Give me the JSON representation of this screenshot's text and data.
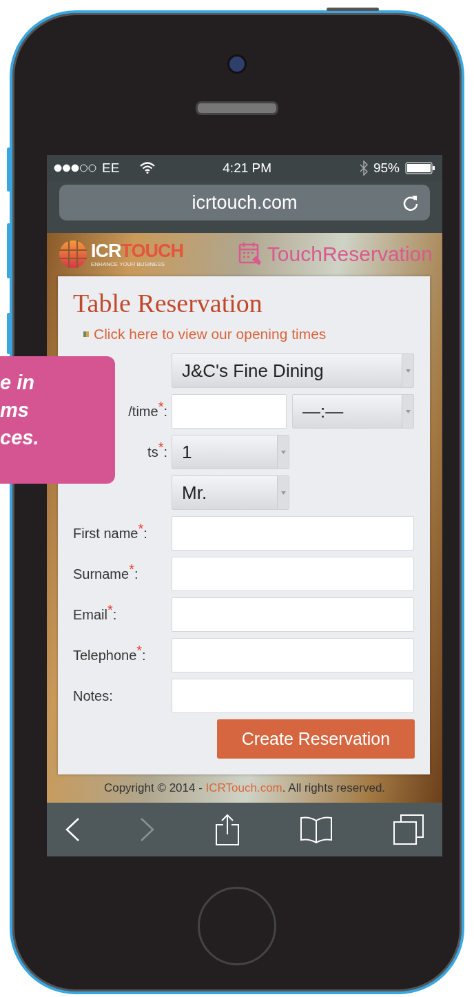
{
  "status_bar": {
    "carrier": "EE",
    "time": "4:21 PM",
    "battery": "95%"
  },
  "address_bar": {
    "url": "icrtouch.com"
  },
  "header": {
    "brand": "ICR",
    "brand_accent": "TOUCH",
    "tagline": "ENHANCE YOUR BUSINESS",
    "product": "TouchReservation"
  },
  "form": {
    "title": "Table Reservation",
    "opening_link": "Click here to view our opening times",
    "rows": [
      {
        "fields": [
          {
            "kind": "select",
            "value": "J&C's Fine Dining",
            "compact": false
          }
        ]
      },
      {
        "label": "/time$^{*}$:",
        "fields": [
          {
            "kind": "input"
          },
          {
            "kind": "select",
            "value": "—:—",
            "compact": false
          }
        ]
      },
      {
        "label": "ts$^{*}$:",
        "fields": [
          {
            "kind": "select",
            "value": "1",
            "compact": true
          }
        ]
      },
      {
        "fields": [
          {
            "kind": "select",
            "value": "Mr.",
            "compact": true
          }
        ]
      },
      {
        "label": "First name$^{*}$:",
        "fields": [
          {
            "kind": "input"
          }
        ]
      },
      {
        "label": "Surname$^{*}$:",
        "fields": [
          {
            "kind": "input"
          }
        ]
      },
      {
        "label": "Email$^{*}$:",
        "fields": [
          {
            "kind": "input"
          }
        ]
      },
      {
        "label": "Telephone$^{*}$:",
        "fields": [
          {
            "kind": "input"
          }
        ]
      },
      {
        "label": "Notes:",
        "fields": [
          {
            "kind": "input"
          }
        ]
      }
    ],
    "submit": "Create Reservation"
  },
  "footer": {
    "prefix": "Copyright © 2014 - ",
    "link": "ICRTouch.com",
    "suffix": ". All rights reserved."
  },
  "toolbar": {
    "back_enabled": true,
    "forward_enabled": false
  },
  "callout": {
    "lines": [
      "e in",
      "ms",
      "ces."
    ]
  }
}
